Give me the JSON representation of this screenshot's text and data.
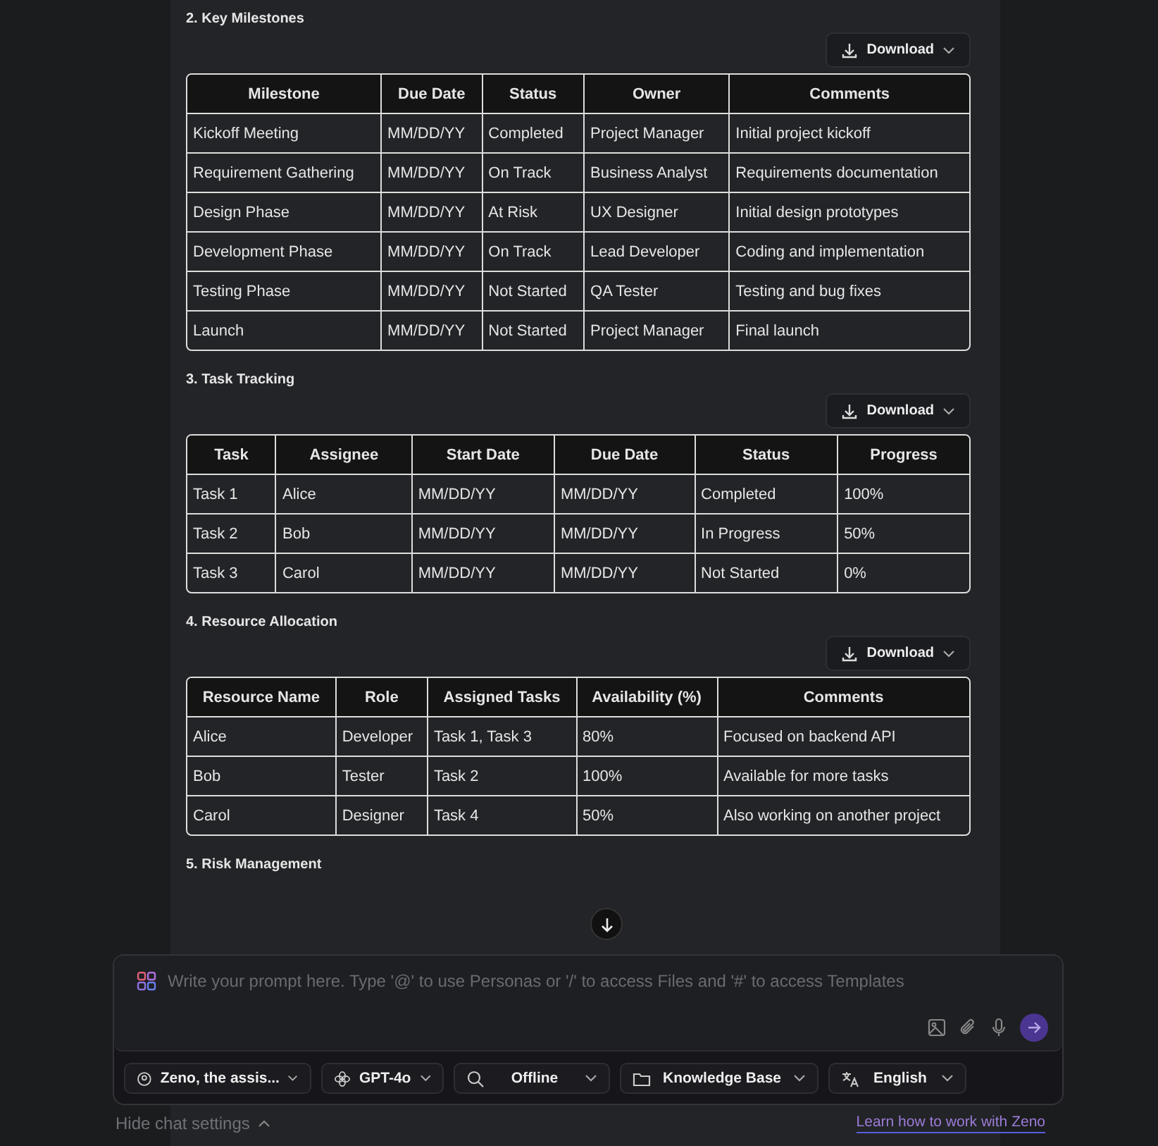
{
  "sections": [
    {
      "title": "2. Key Milestones",
      "download": "Download",
      "columns": [
        "Milestone",
        "Due Date",
        "Status",
        "Owner",
        "Comments"
      ],
      "rows": [
        [
          "Kickoff Meeting",
          "MM/DD/YY",
          "Completed",
          "Project Manager",
          "Initial project kickoff"
        ],
        [
          "Requirement Gathering",
          "MM/DD/YY",
          "On Track",
          "Business Analyst",
          "Requirements documentation"
        ],
        [
          "Design Phase",
          "MM/DD/YY",
          "At Risk",
          "UX Designer",
          "Initial design prototypes"
        ],
        [
          "Development Phase",
          "MM/DD/YY",
          "On Track",
          "Lead Developer",
          "Coding and implementation"
        ],
        [
          "Testing Phase",
          "MM/DD/YY",
          "Not Started",
          "QA Tester",
          "Testing and bug fixes"
        ],
        [
          "Launch",
          "MM/DD/YY",
          "Not Started",
          "Project Manager",
          "Final launch"
        ]
      ]
    },
    {
      "title": "3. Task Tracking",
      "download": "Download",
      "columns": [
        "Task",
        "Assignee",
        "Start Date",
        "Due Date",
        "Status",
        "Progress"
      ],
      "rows": [
        [
          "Task 1",
          "Alice",
          "MM/DD/YY",
          "MM/DD/YY",
          "Completed",
          "100%"
        ],
        [
          "Task 2",
          "Bob",
          "MM/DD/YY",
          "MM/DD/YY",
          "In Progress",
          "50%"
        ],
        [
          "Task 3",
          "Carol",
          "MM/DD/YY",
          "MM/DD/YY",
          "Not Started",
          "0%"
        ]
      ]
    },
    {
      "title": "4. Resource Allocation",
      "download": "Download",
      "columns": [
        "Resource Name",
        "Role",
        "Assigned Tasks",
        "Availability (%)",
        "Comments"
      ],
      "rows": [
        [
          "Alice",
          "Developer",
          "Task 1, Task 3",
          "80%",
          "Focused on backend API"
        ],
        [
          "Bob",
          "Tester",
          "Task 2",
          "100%",
          "Available for more tasks"
        ],
        [
          "Carol",
          "Designer",
          "Task 4",
          "50%",
          "Also working on another project"
        ]
      ]
    },
    {
      "title": "5. Risk Management"
    }
  ],
  "composer": {
    "placeholder": "Write your prompt here. Type '@' to use Personas or '/' to access Files and '#' to access Templates",
    "settings": [
      {
        "kind": "persona",
        "label": "Zeno, the assis..."
      },
      {
        "kind": "model",
        "label": "GPT-4o"
      },
      {
        "kind": "search",
        "label": "Offline"
      },
      {
        "kind": "knowledge",
        "label": "Knowledge Base"
      },
      {
        "kind": "language",
        "label": "English"
      }
    ]
  },
  "hide_settings": "Hide chat settings",
  "learn_link": "Learn how to work with Zeno"
}
